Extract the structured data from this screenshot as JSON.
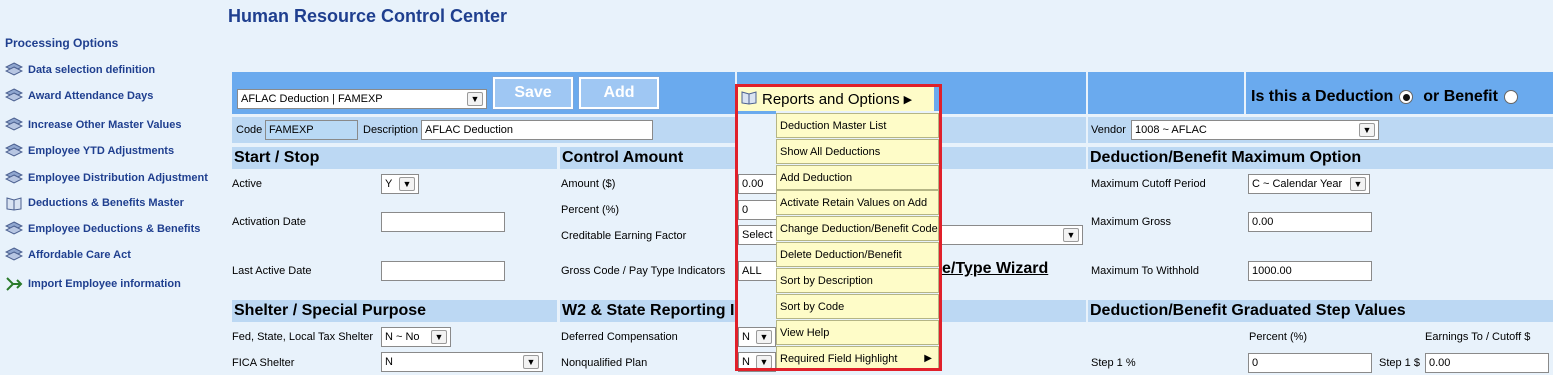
{
  "page_title": "Human Resource Control Center",
  "sidebar": {
    "heading": "Processing Options",
    "items": [
      {
        "label": "Data selection definition",
        "icon": "stack-icon"
      },
      {
        "label": "Award Attendance Days",
        "icon": "stack-icon"
      },
      {
        "label": "Increase Other Master Values",
        "icon": "stack-icon"
      },
      {
        "label": "Employee YTD Adjustments",
        "icon": "stack-icon"
      },
      {
        "label": "Employee Distribution Adjustment",
        "icon": "stack-icon"
      },
      {
        "label": "Deductions & Benefits Master",
        "icon": "book-icon"
      },
      {
        "label": "Employee Deductions & Benefits",
        "icon": "stack-icon"
      },
      {
        "label": "Affordable Care Act",
        "icon": "stack-icon"
      },
      {
        "label": "Import Employee information",
        "icon": "import-icon"
      }
    ]
  },
  "toolbar": {
    "deduction_select": "AFLAC Deduction | FAMEXP",
    "save_label": "Save",
    "add_label": "Add",
    "type_question": "Is this a Deduction",
    "or_benefit": "or Benefit",
    "deduction_selected": true
  },
  "header_fields": {
    "code_label": "Code",
    "code_value": "FAMEXP",
    "description_label": "Description",
    "description_value": "AFLAC Deduction",
    "vendor_label": "Vendor",
    "vendor_value": "1008 ~ AFLAC"
  },
  "start_stop": {
    "title": "Start / Stop",
    "active_label": "Active",
    "active_value": "Y",
    "activation_label": "Activation Date",
    "activation_value": "",
    "last_active_label": "Last Active Date",
    "last_active_value": ""
  },
  "control_amount": {
    "title": "Control Amount",
    "amount_label": "Amount ($)",
    "amount_value": "0.00",
    "percent_label": "Percent (%)",
    "percent_value": "0",
    "creditable_label": "Creditable Earning Factor",
    "creditable_value": "Select",
    "gross_label": "Gross Code / Pay Type Indicators",
    "gross_value": "ALL",
    "wizard_partial": "e/Type Wizard"
  },
  "max_option": {
    "title": "Deduction/Benefit Maximum Option",
    "cutoff_label": "Maximum Cutoff Period",
    "cutoff_value": "C ~ Calendar Year",
    "gross_label": "Maximum Gross",
    "gross_value": "0.00",
    "withhold_label": "Maximum To Withhold",
    "withhold_value": "1000.00"
  },
  "shelter": {
    "title": "Shelter / Special Purpose",
    "tax_label": "Fed, State, Local Tax Shelter",
    "tax_value": "N ~ No",
    "fica_label": "FICA Shelter",
    "fica_value": "N"
  },
  "w2": {
    "title": "W2 & State Reporting Inf",
    "deferred_label": "Deferred Compensation",
    "deferred_value": "N",
    "nonqual_label": "Nonqualified Plan",
    "nonqual_value": "N"
  },
  "graduated": {
    "title": "Deduction/Benefit Graduated Step Values",
    "percent_col": "Percent (%)",
    "earnings_col": "Earnings To / Cutoff $",
    "step1_pct_label": "Step 1 %",
    "step1_pct_value": "0",
    "step1_amt_label": "Step 1 $",
    "step1_amt_value": "0.00"
  },
  "reports_menu": {
    "label": "Reports and Options",
    "items": [
      "Deduction Master List",
      "Show All Deductions",
      "Add Deduction",
      "Activate Retain Values on Add",
      "Change Deduction/Benefit Code",
      "Delete Deduction/Benefit",
      "Sort by Description",
      "Sort by Code",
      "View Help",
      "Required Field Highlight"
    ]
  },
  "colors": {
    "title_blue": "#1f3f8f",
    "band_blue": "#6aaaee",
    "section_blue": "#bcd8f3",
    "menu_yellow": "#fefcc8",
    "highlight_red": "#e0202a"
  }
}
